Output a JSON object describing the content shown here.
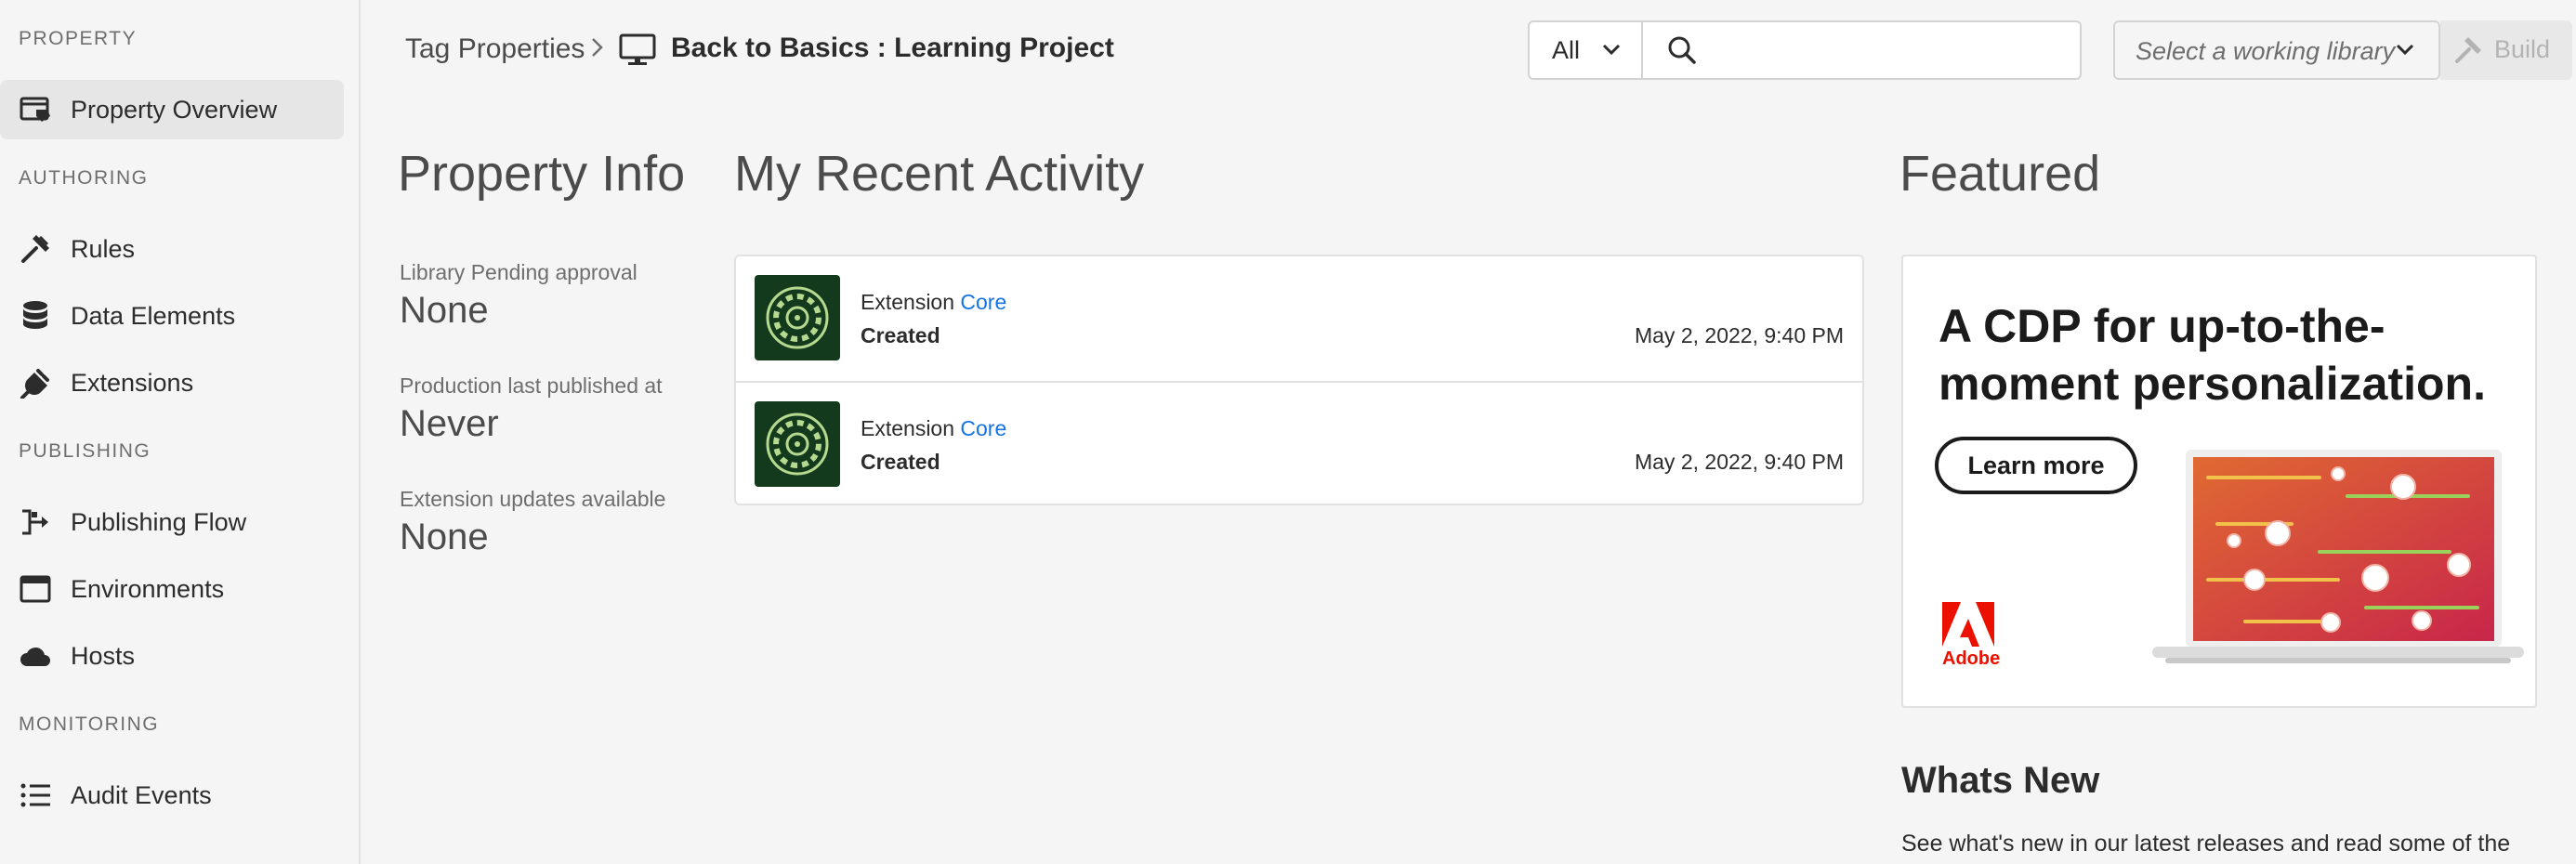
{
  "sidebar": {
    "sections": {
      "property": "PROPERTY",
      "authoring": "AUTHORING",
      "publishing": "PUBLISHING",
      "monitoring": "MONITORING"
    },
    "items": {
      "property_overview": "Property Overview",
      "rules": "Rules",
      "data_elements": "Data Elements",
      "extensions": "Extensions",
      "publishing_flow": "Publishing Flow",
      "environments": "Environments",
      "hosts": "Hosts",
      "audit_events": "Audit Events"
    }
  },
  "header": {
    "breadcrumb_root": "Tag Properties",
    "property_name": "Back to Basics : Learning Project",
    "search_scope": "All",
    "search_placeholder": "",
    "library_select": "Select a working library",
    "build_label": "Build"
  },
  "property_info": {
    "title": "Property Info",
    "fields": [
      {
        "label": "Library Pending approval",
        "value": "None"
      },
      {
        "label": "Production last published at",
        "value": "Never"
      },
      {
        "label": "Extension updates available",
        "value": "None"
      }
    ]
  },
  "recent_activity": {
    "title": "My Recent Activity",
    "items": [
      {
        "type": "Extension",
        "name": "Core",
        "status": "Created",
        "time": "May 2, 2022, 9:40 PM"
      },
      {
        "type": "Extension",
        "name": "Core",
        "status": "Created",
        "time": "May 2, 2022, 9:40 PM"
      }
    ]
  },
  "featured": {
    "title": "Featured",
    "headline": "A CDP for up-to-the-moment personalization.",
    "cta": "Learn more",
    "brand": "Adobe",
    "brand_color": "#eb1000"
  },
  "whats_new": {
    "title": "Whats New",
    "description": "See what's new in our latest releases and read some of the"
  },
  "colors": {
    "accent": "#1473e6",
    "extension_icon_bg": "#143a1d"
  }
}
